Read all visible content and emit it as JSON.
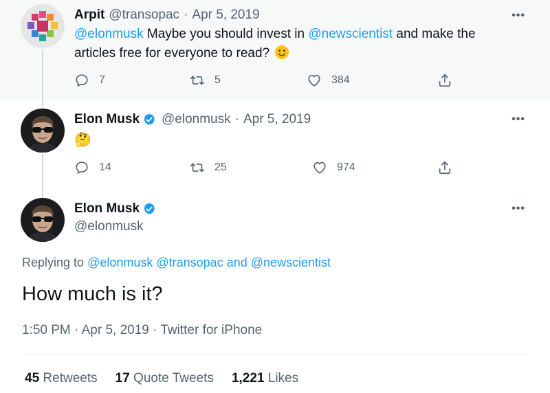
{
  "tweet1": {
    "name": "Arpit",
    "handle": "@transopac",
    "sep": "·",
    "date": "Apr 5, 2019",
    "mention1": "@elonmusk",
    "text1": " Maybe you should invest in ",
    "mention2": "@newscientist",
    "text2": " and make the",
    "line2": "articles free for everyone to read?",
    "emoji": "slightly-smiling-face",
    "more": "•••",
    "replies": "7",
    "retweets": "5",
    "likes": "384"
  },
  "tweet2": {
    "name": "Elon Musk",
    "handle": "@elonmusk",
    "sep": "·",
    "date": "Apr 5, 2019",
    "emoji": "🤔",
    "more": "•••",
    "replies": "14",
    "retweets": "25",
    "likes": "974"
  },
  "main": {
    "name": "Elon Musk",
    "handle": "@elonmusk",
    "more": "•••",
    "replying_prefix": "Replying to ",
    "replying_mentions": "@elonmusk @transopac and @newscientist",
    "text": "How much is it?",
    "meta": "1:50 PM · Apr 5, 2019 · Twitter for iPhone",
    "retweets_num": "45",
    "retweets_label": " Retweets",
    "quotes_num": "17",
    "quotes_label": " Quote Tweets",
    "likes_num": "1,221",
    "likes_label": " Likes"
  },
  "colors": {
    "link": "#1d9bf0",
    "verified": "#1d9bf0",
    "muted": "#536471",
    "highlight_bg": "#f7f9f9"
  }
}
